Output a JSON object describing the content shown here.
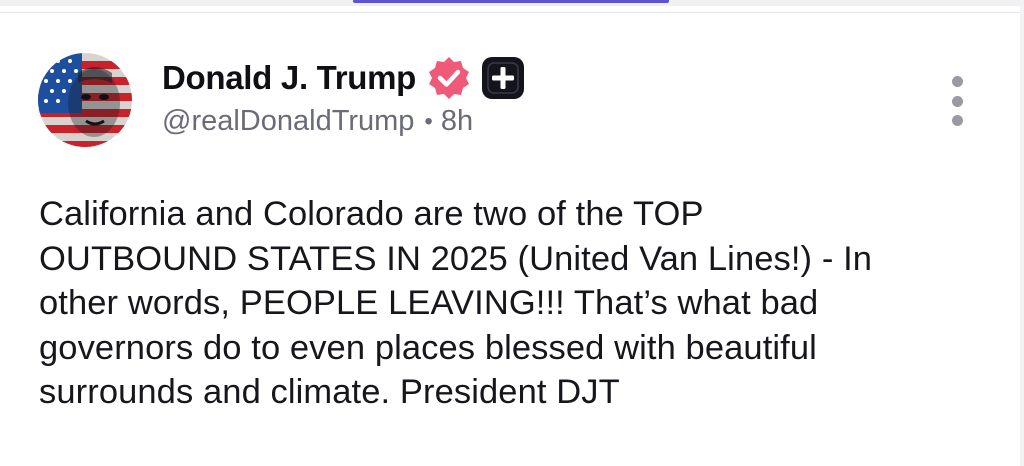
{
  "post": {
    "author": {
      "display_name": "Donald J. Trump",
      "handle": "@realDonaldTrump",
      "avatar_icon": "flag-portrait-avatar",
      "verified_icon": "verified-badge-icon",
      "plus_icon": "plus-badge-icon"
    },
    "separator": "•",
    "timestamp": "8h",
    "menu_icon": "more-vertical-icon",
    "body_lines": [
      "California and Colorado are two of the TOP",
      "OUTBOUND STATES IN 2025 (United Van Lines!) - In",
      "other words, PEOPLE LEAVING!!! That’s what bad",
      "governors do to even places blessed with beautiful",
      "surrounds and climate. President DJT"
    ]
  },
  "colors": {
    "accent": "#5b55d6",
    "verified": "#ef5a78",
    "text": "#16161c",
    "muted": "#6b6b78"
  }
}
